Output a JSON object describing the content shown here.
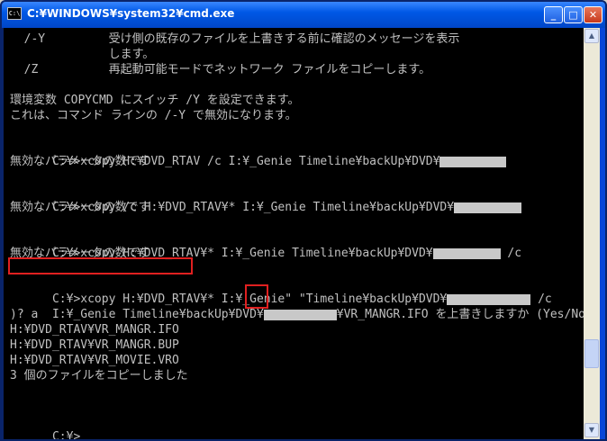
{
  "window": {
    "title": "C:¥WINDOWS¥system32¥cmd.exe",
    "icon_label": "C:\\",
    "minimize_glyph": "_",
    "maximize_glyph": "□",
    "close_glyph": "✕"
  },
  "console": {
    "lines": [
      "  /-Y         受け側の既存のファイルを上書きする前に確認のメッセージを表示",
      "              します。",
      "  /Z          再起動可能モードでネットワーク ファイルをコピーします。",
      "",
      "環境変数 COPYCMD にスイッチ /Y を設定できます。",
      "これは、コマンド ラインの /-Y で無効になります。",
      "",
      "C:¥>xcopy H:¥DVD_RTAV /c I:¥_Genie Timeline¥backUp¥DVD¥",
      "無効なパラメータの数です",
      "",
      "C:¥>xcopy /c H:¥DVD_RTAV¥* I:¥_Genie Timeline¥backUp¥DVD¥",
      "無効なパラメータの数です",
      "",
      "C:¥>xcopy H:¥DVD_RTAV¥* I:¥_Genie Timeline¥backUp¥DVD¥",
      "無効なパラメータの数です",
      "",
      "C:¥>xcopy H:¥DVD_RTAV¥* I:¥_Genie\" \"Timeline¥backUp¥DVD¥",
      "I:¥_Genie Timeline¥backUp¥DVD¥",
      ")? a",
      "H:¥DVD_RTAV¥VR_MANGR.IFO",
      "H:¥DVD_RTAV¥VR_MANGR.BUP",
      "H:¥DVD_RTAV¥VR_MOVIE.VRO",
      "3 個のファイルをコピーしました",
      "",
      "C:¥>"
    ],
    "suffix_13": " /c",
    "suffix_16": " /c",
    "suffix_17": "¥VR_MANGR.IFO を上書きしますか (Yes/No/A"
  },
  "scrollbar": {
    "up_glyph": "▲",
    "down_glyph": "▼"
  },
  "colors": {
    "console_bg": "#000000",
    "console_text": "#c0c0c0",
    "highlight": "#e02020",
    "titlebar": "#0058e6"
  }
}
